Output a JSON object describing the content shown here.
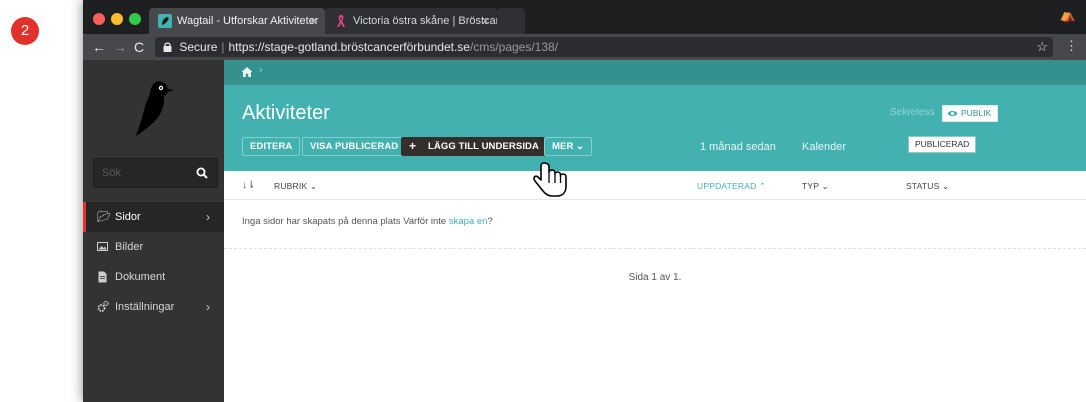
{
  "step_badge": "2",
  "browser": {
    "tabs": [
      {
        "label": "Wagtail - Utforskar Aktiviteter",
        "close": "×"
      },
      {
        "label": "Victoria östra skåne | Bröstcan",
        "close": "×"
      }
    ],
    "address": {
      "secure_label": "Secure",
      "separator": "|",
      "url_host": "https://stage-gotland.bröstcancerförbundet.se",
      "url_path": "/cms/pages/138/"
    },
    "nav": {
      "back": "←",
      "forward": "→",
      "reload": "C",
      "star": "☆",
      "menu": "⋮",
      "incognito": "⛺"
    }
  },
  "sidebar": {
    "search": {
      "placeholder": "Sök"
    },
    "items": [
      {
        "label": "Sidor",
        "icon": "folder-open-icon",
        "active": true,
        "chevron": "›"
      },
      {
        "label": "Bilder",
        "icon": "image-icon",
        "active": false
      },
      {
        "label": "Dokument",
        "icon": "document-icon",
        "active": false
      },
      {
        "label": "Inställningar",
        "icon": "cogs-icon",
        "active": false,
        "chevron": "›"
      }
    ]
  },
  "header": {
    "breadcrumb_sep": "›",
    "title": "Aktiviteter",
    "buttons": {
      "edit": "EDITERA",
      "view_live": "VISA PUBLICERAD",
      "add_child": "LÄGG TILL UNDERSIDA",
      "add_plus": "+",
      "more": "MER ⌄"
    },
    "updated": "1 månad sedan",
    "template": "Kalender",
    "privacy_label": "Sekretess",
    "privacy_value": "PUBLIK",
    "status": "PUBLICERAD"
  },
  "listing": {
    "sort_icon": "↓⇂",
    "columns": {
      "title": "RUBRIK ⌄",
      "updated": "UPPDATERAD ⌃",
      "type": "TYP ⌄",
      "status": "STATUS ⌄"
    },
    "empty_text": "Inga sidor har skapats på denna plats Varför inte ",
    "empty_link": "skapa en",
    "empty_end": "?",
    "pagination": "Sida 1 av 1."
  },
  "colors": {
    "teal": "#43b1b0",
    "teal_dark": "#35918e",
    "sidebar": "#333333",
    "accent_red": "#e4302f"
  }
}
